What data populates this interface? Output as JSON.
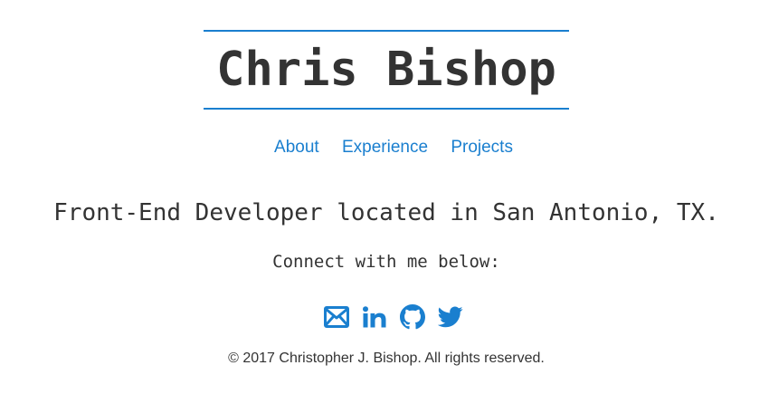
{
  "header": {
    "name": "Chris Bishop"
  },
  "nav": {
    "items": [
      {
        "label": "About"
      },
      {
        "label": "Experience"
      },
      {
        "label": "Projects"
      }
    ]
  },
  "main": {
    "tagline": "Front-End Developer located in San Antonio, TX.",
    "connect_text": "Connect with me below:"
  },
  "social": {
    "icons": [
      "email-icon",
      "linkedin-icon",
      "github-icon",
      "twitter-icon"
    ],
    "color": "#1a7fcf"
  },
  "footer": {
    "copyright": "© 2017 Christopher J. Bishop. All rights reserved."
  },
  "colors": {
    "accent": "#1a7fcf",
    "text": "#333333",
    "background": "#ffffff"
  }
}
